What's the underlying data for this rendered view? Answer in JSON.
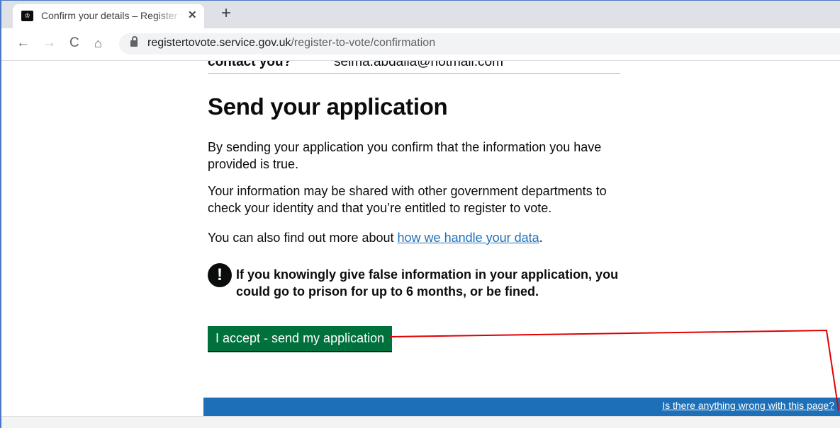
{
  "browser": {
    "tab": {
      "title": "Confirm your details – Register to Vote",
      "close_glyph": "✕",
      "favicon": "crown-icon"
    },
    "new_tab_glyph": "+",
    "nav": {
      "back": "←",
      "forward": "→",
      "reload": "C",
      "home": "⌂"
    },
    "address_bar": {
      "host": "registertovote.service.gov.uk",
      "path": "/register-to-vote/confirmation"
    }
  },
  "page": {
    "summary_row": {
      "key": "contact you?",
      "value": "selma.abdalla@hotmail.com"
    },
    "heading": "Send your application",
    "paragraph_1": "By sending your application you confirm that the information you have provided is true.",
    "paragraph_2": "Your information may be shared with other government departments to check your identity and that you’re entitled to register to vote.",
    "paragraph_3_prefix": "You can also find out more about ",
    "paragraph_3_link": "how we handle your data",
    "paragraph_3_suffix": ".",
    "warning": {
      "icon": "!",
      "text": "If you knowingly give false information in your application, you could go to prison for up to 6 months, or be fined."
    },
    "accept_button": "I accept - send my application",
    "feedback_link": "Is there anything wrong with this page?"
  },
  "colors": {
    "govuk_blue": "#1d70b8",
    "button_green": "#00703c",
    "annotation_red": "#e00000",
    "text": "#0b0c0c"
  }
}
